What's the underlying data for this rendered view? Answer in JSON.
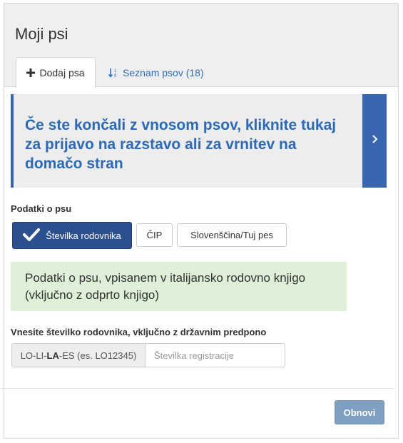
{
  "panel": {
    "title": "Moji psi",
    "tabs": [
      {
        "label": "Dodaj psa",
        "icon": "plus-icon",
        "active": true
      },
      {
        "label": "Seznam psov (18)",
        "icon": "sort-numeric-icon",
        "active": false
      }
    ]
  },
  "callout": {
    "text": "Če ste končali z vnosom psov, kliknite tukaj za prijavo na razstavo ali za vrnitev na domačo stran",
    "icon": "chevron-right-icon"
  },
  "dog_data": {
    "label": "Podatki o psu",
    "options": [
      {
        "label": "Številka rodovnika",
        "selected": true,
        "icon": "checkmark-icon"
      },
      {
        "label": "ČIP",
        "selected": false
      },
      {
        "label": "Slovenščina/Tuj pes",
        "selected": false
      }
    ],
    "info": "Podatki o psu, vpisanem v italijansko rodovno knjigo (vključno z odprto knjigo)"
  },
  "registration": {
    "label": "Vnesite številko rodovnika, vključno z državnim predpono",
    "prefix_before": "LO-LI-",
    "prefix_bold": "LA",
    "prefix_after": "-ES (es. LO12345)",
    "placeholder": "Številka registracije",
    "value": ""
  },
  "footer": {
    "refresh_label": "Obnovi"
  },
  "colors": {
    "primary": "#2c4f8f",
    "accent_blue": "#3a66b0",
    "link_blue": "#2c6ab5",
    "success_bg": "#dff0d8",
    "button_muted": "#7e9fc1"
  }
}
